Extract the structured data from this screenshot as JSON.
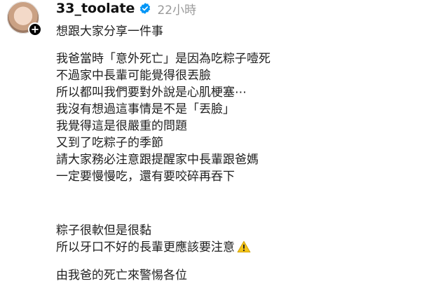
{
  "post": {
    "username": "33_toolate",
    "time": "22小時",
    "intro": "想跟大家分享一件事",
    "paragraph1": [
      "我爸當時「意外死亡」是因為吃粽子噎死",
      "不過家中長輩可能覺得很丟臉",
      "所以都叫我們要對外說是心肌梗塞⋯",
      "我沒有想過這事情是不是「丟臉」",
      "我覺得這是很嚴重的問題",
      "又到了吃粽子的季節",
      "請大家務必注意跟提醒家中長輩跟爸媽",
      "一定要慢慢吃，還有要咬碎再吞下"
    ],
    "paragraph2": [
      "粽子很軟但是很黏",
      "所以牙口不好的長輩更應該要注意"
    ],
    "paragraph3": [
      "由我爸的死亡來警惕各位"
    ]
  },
  "icons": {
    "verified": "verified-badge-icon",
    "warning": "warning-icon",
    "follow": "plus-icon"
  },
  "colors": {
    "verified": "#0095f6",
    "warning": "#f5c518",
    "text": "#1f1f1f",
    "muted": "#9a9a9a"
  }
}
